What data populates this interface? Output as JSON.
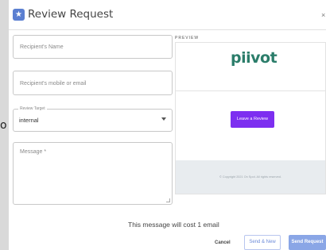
{
  "background": {
    "fragment_text": "o"
  },
  "dialog": {
    "title": "Review Request",
    "icon": "star-icon",
    "close_label": "×"
  },
  "form": {
    "recipient_name": {
      "placeholder": "Recipient's Name",
      "value": ""
    },
    "recipient_contact": {
      "placeholder": "Recipient's mobile or email",
      "value": ""
    },
    "review_target": {
      "label": "Review Target",
      "selected": "internal",
      "options": [
        "internal"
      ]
    },
    "message": {
      "placeholder": "Message *",
      "value": ""
    }
  },
  "preview": {
    "label": "PREVIEW",
    "logo": "piivot",
    "button_label": "Leave a Review",
    "copyright": "© Copyright 2021 On Spot. All rights reserved."
  },
  "cost_text": "This message will cost 1 email",
  "actions": {
    "cancel": "Cancel",
    "send_new": "Send & New",
    "send": "Send Request"
  },
  "colors": {
    "accent": "#5b7fd1",
    "logo": "#2b7d6a",
    "review_button": "#7d2ff0",
    "send_button": "#8aa6e6",
    "preview_footer": "#e8ecef"
  }
}
